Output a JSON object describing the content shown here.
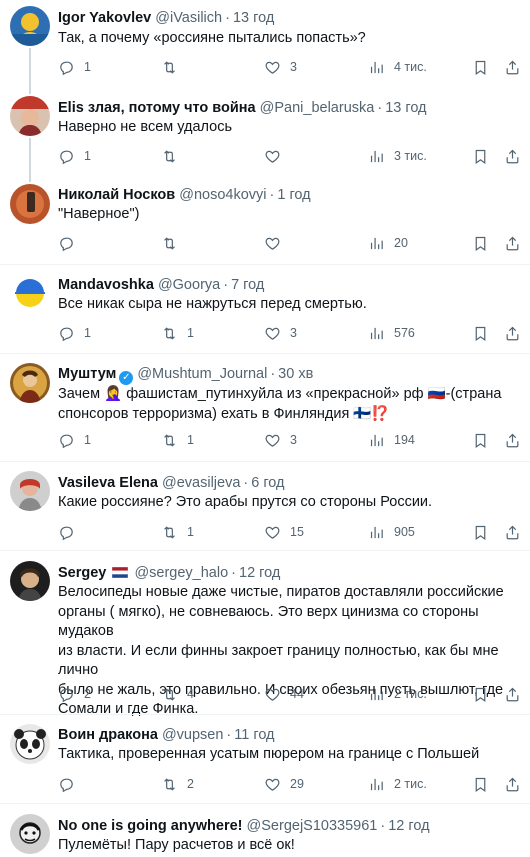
{
  "tweets": [
    {
      "name": "Igor Yakovlev",
      "handle": "@iVasilich",
      "time": "13 год",
      "text": "Так, а почему «россияне пытались попасть»?",
      "reply": "1",
      "retweet": "",
      "like": "3",
      "views": "4 тис."
    },
    {
      "name": "Elis злая, потому что война",
      "handle": "@Pani_belaruska",
      "time": "13 год",
      "text": "Наверно не всем удалось",
      "reply": "1",
      "retweet": "",
      "like": "",
      "views": "3 тис."
    },
    {
      "name": "Николай Носков",
      "handle": "@noso4kovyi",
      "time": "1 год",
      "text": "\"Наверное\")",
      "reply": "",
      "retweet": "",
      "like": "",
      "views": "20"
    },
    {
      "name": "Mandavoshka",
      "handle": "@Goorya",
      "time": "7 год",
      "text": "Все никак сыра не нажруться перед смертью.",
      "reply": "1",
      "retweet": "1",
      "like": "3",
      "views": "576"
    },
    {
      "name": "Муштум",
      "handle": "@Mushtum_Journal",
      "time": "30 хв",
      "text_line1": "Зачем 🤦‍♀️ фашистам_путинхуйла из «прекрасной» рф 🇷🇺-(страна",
      "text_line2": "спонсоров терроризма) ехать в Финляндия 🇫🇮⁉️",
      "reply": "1",
      "retweet": "1",
      "like": "3",
      "views": "194"
    },
    {
      "name": "Vasileva Elena",
      "handle": "@evasiljeva",
      "time": "6 год",
      "text": "Какие россияне? Это арабы прутся со стороны России.",
      "reply": "",
      "retweet": "1",
      "like": "15",
      "views": "905"
    },
    {
      "name": "Sergey",
      "handle": "@sergey_halo",
      "time": "12 год",
      "lines": [
        "Велосипеды новые даже чистые, пиратов доставляли российские",
        "органы ( мягко), не совневаюсь. Это верх цинизма со стороны мудаков",
        "из власти. И если финны закроет границу полностью, как бы мне лично",
        "было не жаль, это правильно. И своих обезьян пусть вышлют, где",
        "Сомали и где Финка."
      ],
      "reply": "2",
      "retweet": "4",
      "like": "44",
      "views": "2 тис."
    },
    {
      "name": "Воин дракона",
      "handle": "@vupsen",
      "time": "11 год",
      "text": "Тактика, проверенная усатым пюрером на границе с Польшей",
      "reply": "",
      "retweet": "2",
      "like": "29",
      "views": "2 тис."
    },
    {
      "name": "No one is going anywhere!",
      "handle": "@SergejS10335961",
      "time": "12 год",
      "text": "Пулемёты! Пару расчетов и всё ок!"
    }
  ],
  "icons": {
    "reply": "reply-icon",
    "retweet": "retweet-icon",
    "like": "like-icon",
    "views": "views-icon",
    "bookmark": "bookmark-icon",
    "share": "share-icon"
  },
  "colors": {
    "text": "#0f1419",
    "secondary": "#536471",
    "verified": "#1d9bf0",
    "separator": "#eff3f4"
  }
}
